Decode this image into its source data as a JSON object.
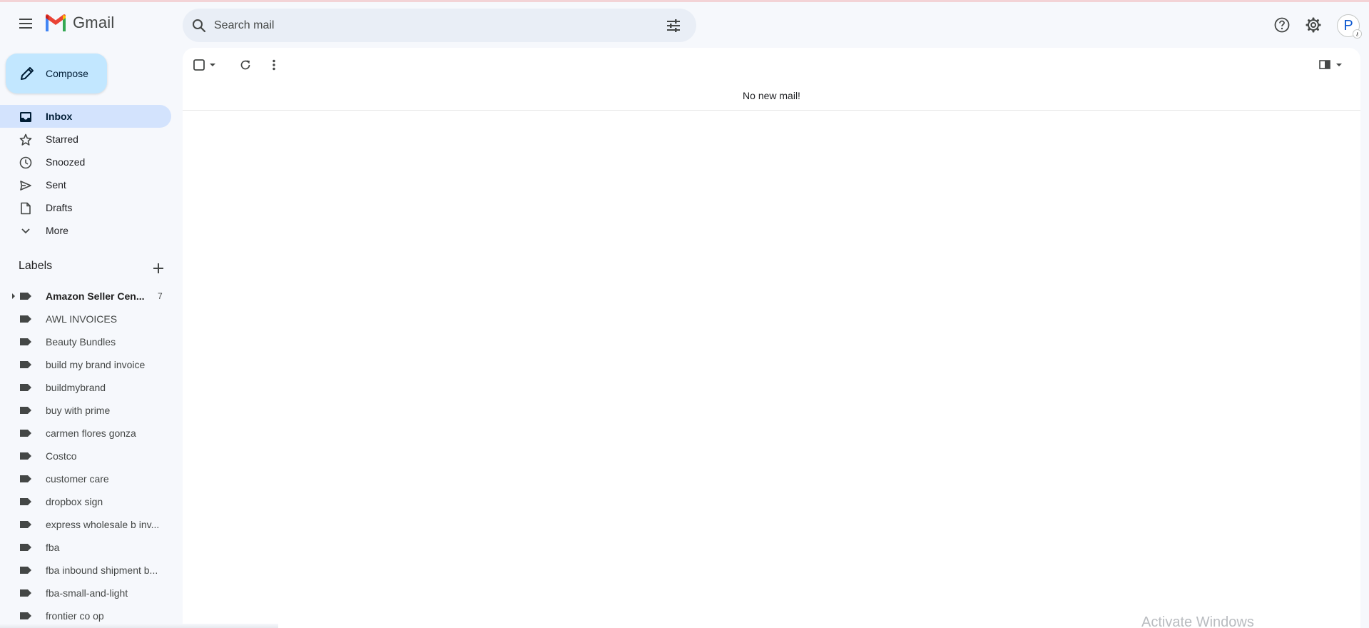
{
  "app": {
    "name": "Gmail"
  },
  "search": {
    "placeholder": "Search mail"
  },
  "compose": {
    "label": "Compose"
  },
  "nav": {
    "items": [
      {
        "label": "Inbox",
        "icon": "inbox-icon",
        "active": true
      },
      {
        "label": "Starred",
        "icon": "star-icon"
      },
      {
        "label": "Snoozed",
        "icon": "clock-icon"
      },
      {
        "label": "Sent",
        "icon": "send-icon"
      },
      {
        "label": "Drafts",
        "icon": "draft-icon"
      },
      {
        "label": "More",
        "icon": "chevron-down-icon"
      }
    ]
  },
  "labels": {
    "heading": "Labels",
    "items": [
      {
        "label": "Amazon Seller Cen...",
        "count": "7",
        "bold": true,
        "expandable": true
      },
      {
        "label": "AWL INVOICES"
      },
      {
        "label": "Beauty Bundles"
      },
      {
        "label": "build my brand invoice"
      },
      {
        "label": "buildmybrand"
      },
      {
        "label": "buy with prime"
      },
      {
        "label": "carmen flores gonza"
      },
      {
        "label": "Costco"
      },
      {
        "label": "customer care"
      },
      {
        "label": "dropbox sign"
      },
      {
        "label": "express wholesale b inv..."
      },
      {
        "label": "fba"
      },
      {
        "label": "fba inbound shipment b..."
      },
      {
        "label": "fba-small-and-light"
      },
      {
        "label": "frontier co op"
      }
    ]
  },
  "main": {
    "empty_message": "No new mail!"
  },
  "header": {
    "avatar_letter": "P"
  },
  "overlay": {
    "watermark": "Activate Windows"
  },
  "colors": {
    "accent": "#0b57d0",
    "active_nav": "#d3e3fd",
    "compose_bg": "#c2e7ff",
    "app_bg": "#f6f8fc"
  }
}
